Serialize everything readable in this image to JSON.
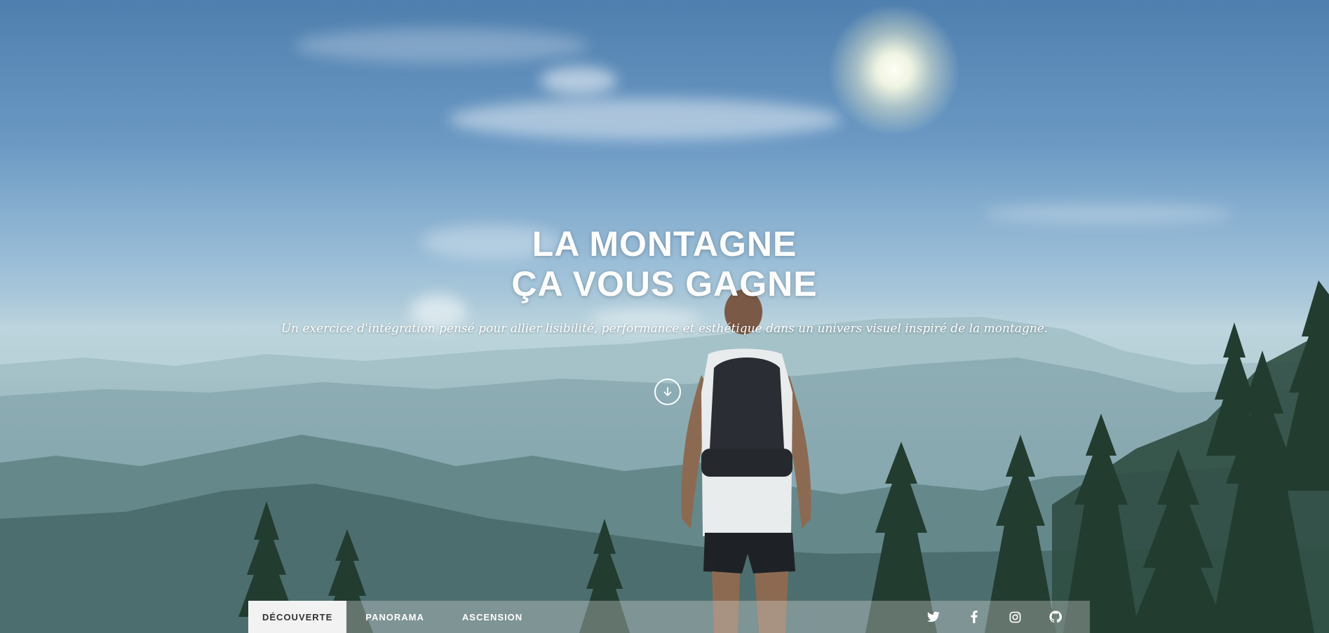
{
  "hero": {
    "title_line1": "LA MONTAGNE",
    "title_line2": "ÇA VOUS GAGNE",
    "subtitle": "Un exercice d'intégration pensé pour allier lisibilité, performance et esthétique dans un univers visuel inspiré de la montagne.",
    "scroll_icon": "arrow-down-icon"
  },
  "nav": {
    "items": [
      {
        "label": "DÉCOUVERTE",
        "active": true
      },
      {
        "label": "PANORAMA",
        "active": false
      },
      {
        "label": "ASCENSION",
        "active": false
      }
    ],
    "social": [
      {
        "icon": "twitter-icon"
      },
      {
        "icon": "facebook-icon"
      },
      {
        "icon": "instagram-icon"
      },
      {
        "icon": "github-icon"
      }
    ]
  },
  "colors": {
    "text": "#ffffff",
    "nav_active_bg": "#f2f2f2",
    "nav_active_text": "#333333"
  }
}
